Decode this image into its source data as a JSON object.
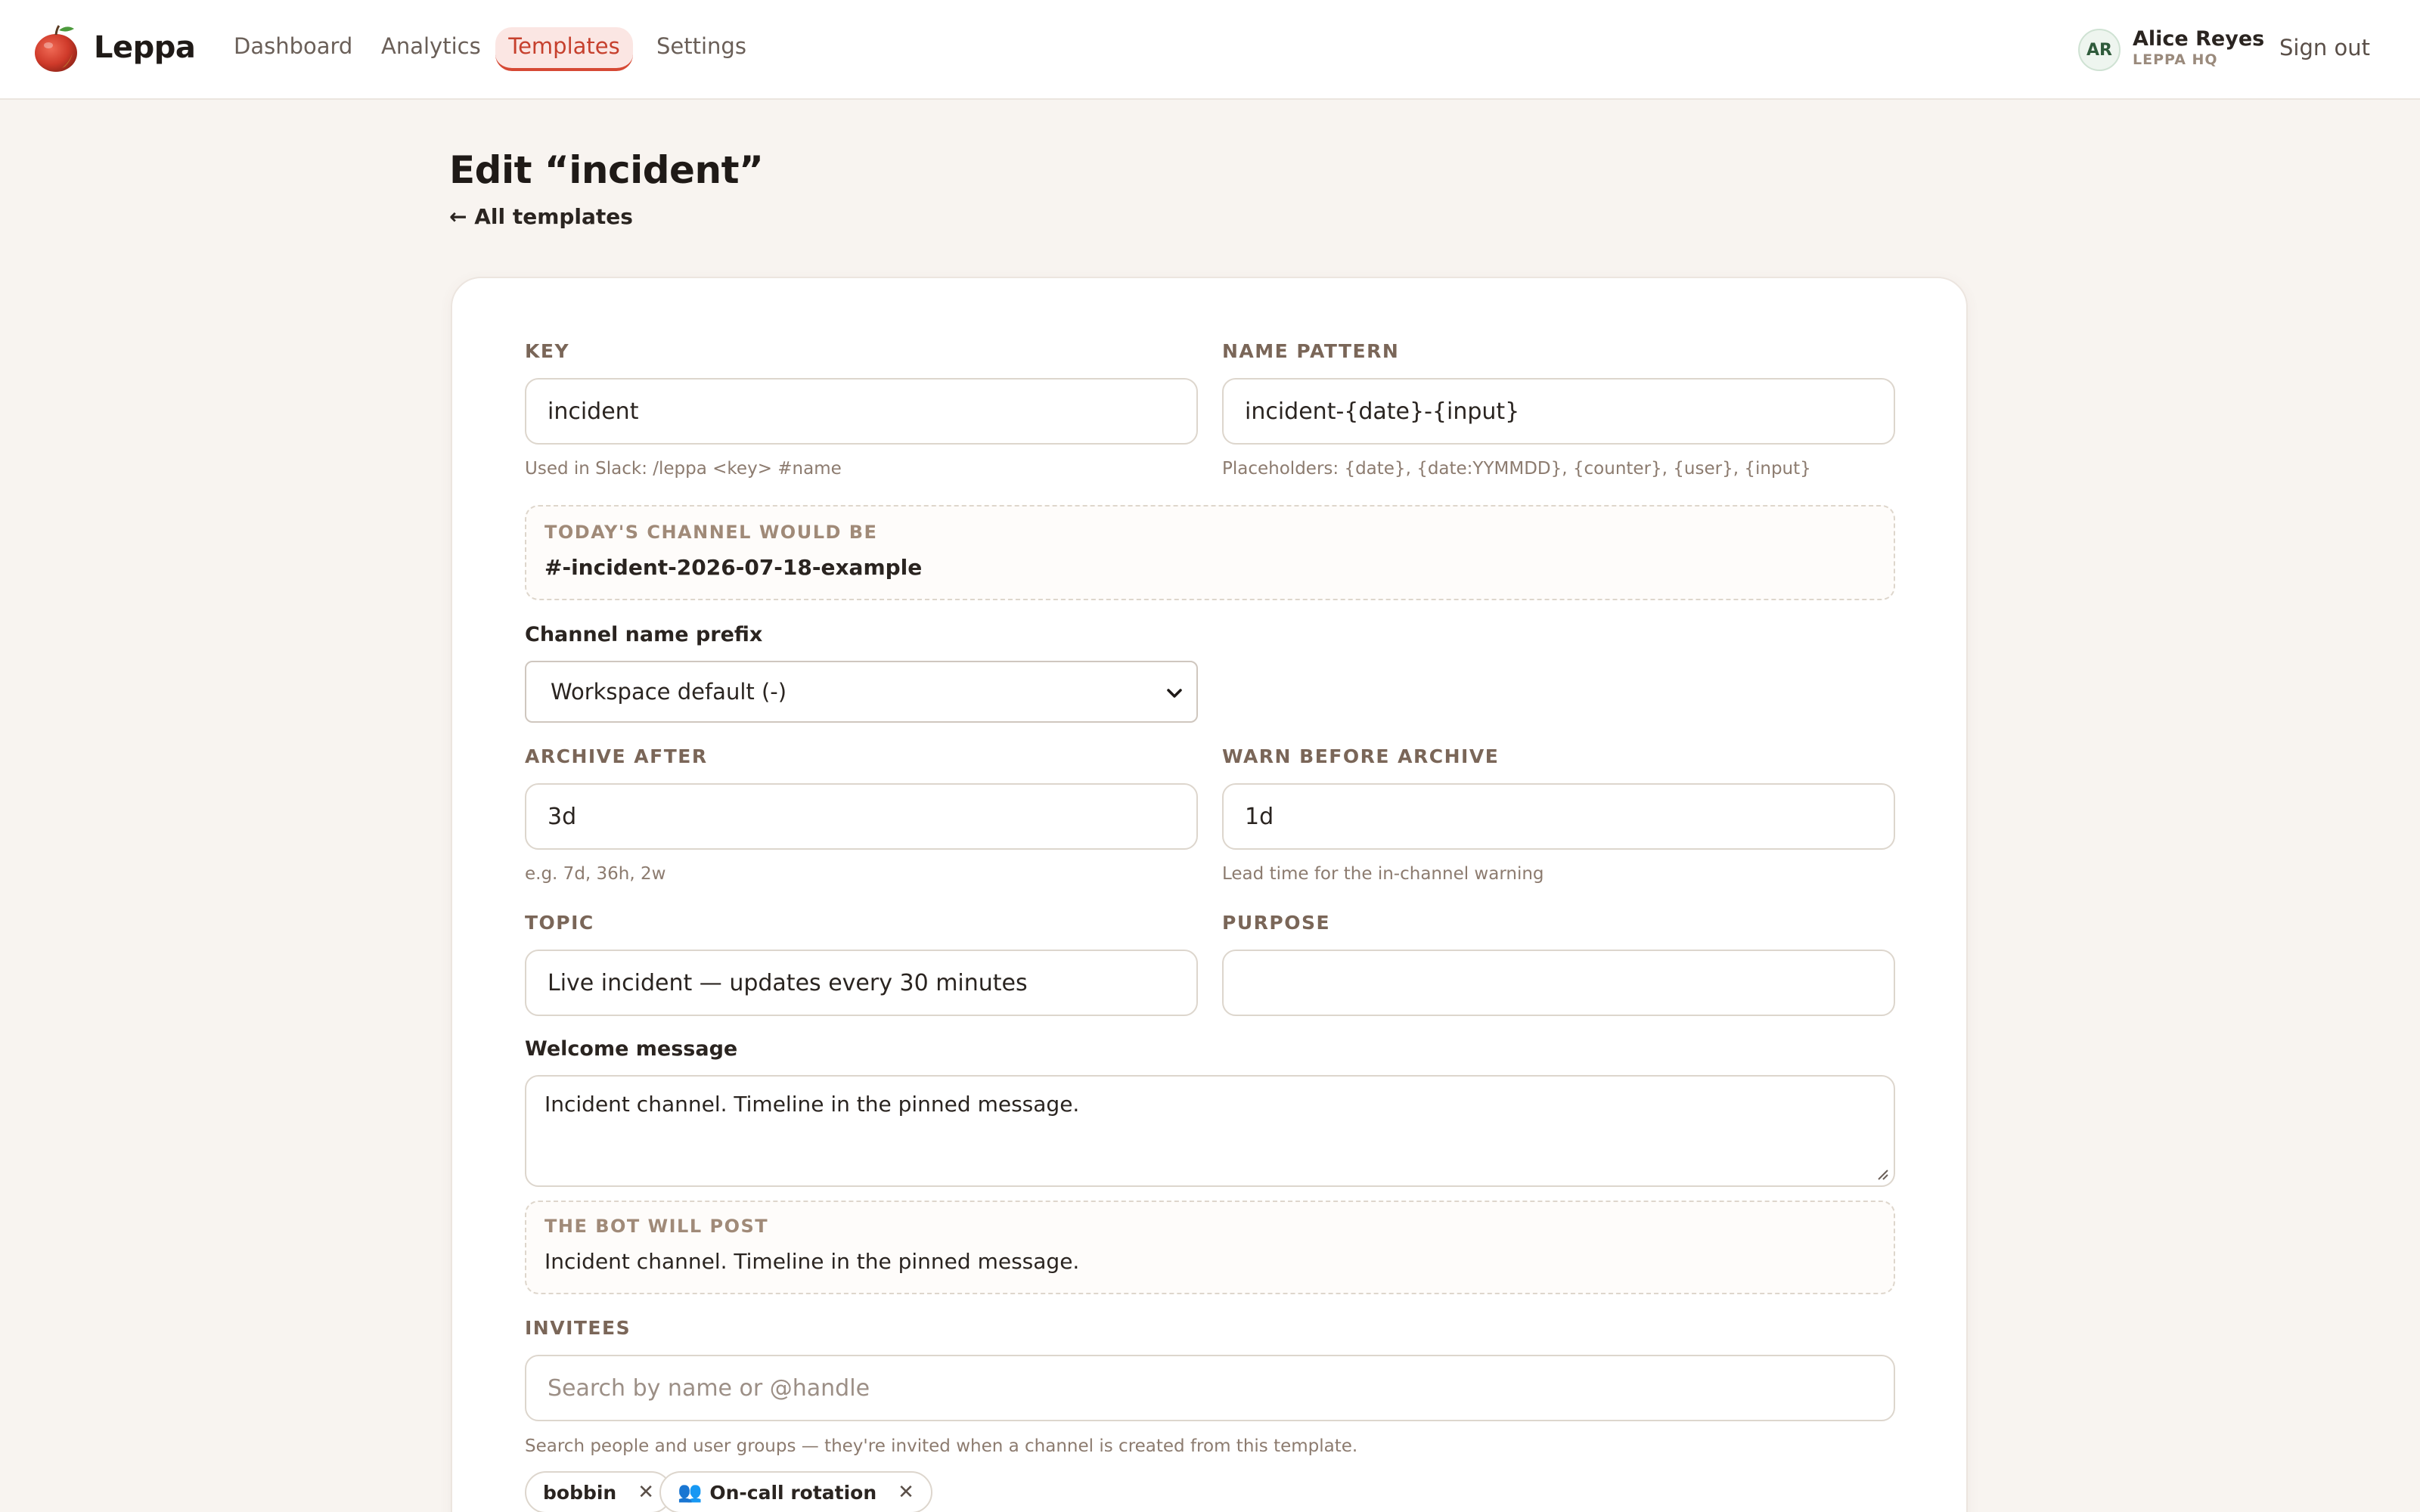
{
  "brand": {
    "name": "Leppa"
  },
  "nav": {
    "items": [
      {
        "label": "Dashboard"
      },
      {
        "label": "Analytics"
      },
      {
        "label": "Templates"
      },
      {
        "label": "Settings"
      }
    ],
    "active": "Templates"
  },
  "user": {
    "initials": "AR",
    "name": "Alice Reyes",
    "org": "LEPPA HQ",
    "sign_out": "Sign out"
  },
  "page": {
    "title": "Edit “incident”",
    "back": "← All templates"
  },
  "form": {
    "key": {
      "label": "KEY",
      "value": "incident",
      "help": "Used in Slack: /leppa <key> #name"
    },
    "name_pattern": {
      "label": "NAME PATTERN",
      "value": "incident-{date}-{input}",
      "help": "Placeholders: {date}, {date:YYMMDD}, {counter}, {user}, {input}"
    },
    "channel_preview": {
      "label": "TODAY'S CHANNEL WOULD BE",
      "value": "#-incident-2026-07-18-example"
    },
    "prefix": {
      "label": "Channel name prefix",
      "value": "Workspace default (-)"
    },
    "archive_after": {
      "label": "ARCHIVE AFTER",
      "value": "3d",
      "help": "e.g. 7d, 36h, 2w"
    },
    "warn_before": {
      "label": "WARN BEFORE ARCHIVE",
      "value": "1d",
      "help": "Lead time for the in-channel warning"
    },
    "topic": {
      "label": "TOPIC",
      "value": "Live incident — updates every 30 minutes"
    },
    "purpose": {
      "label": "PURPOSE",
      "value": ""
    },
    "welcome": {
      "label": "Welcome message",
      "value": "Incident channel. Timeline in the pinned message."
    },
    "bot_preview": {
      "label": "THE BOT WILL POST",
      "value": "Incident channel. Timeline in the pinned message."
    },
    "invitees": {
      "label": "INVITEES",
      "placeholder": "Search by name or @handle",
      "help": "Search people and user groups — they're invited when a channel is created from this template.",
      "chips": [
        {
          "label": "bobbin",
          "type": "user"
        },
        {
          "label": "On-call rotation",
          "type": "group"
        }
      ]
    }
  },
  "colors": {
    "accent": "#d64934",
    "accent_bg": "#fbe6e3",
    "background": "#f8f4f0"
  }
}
